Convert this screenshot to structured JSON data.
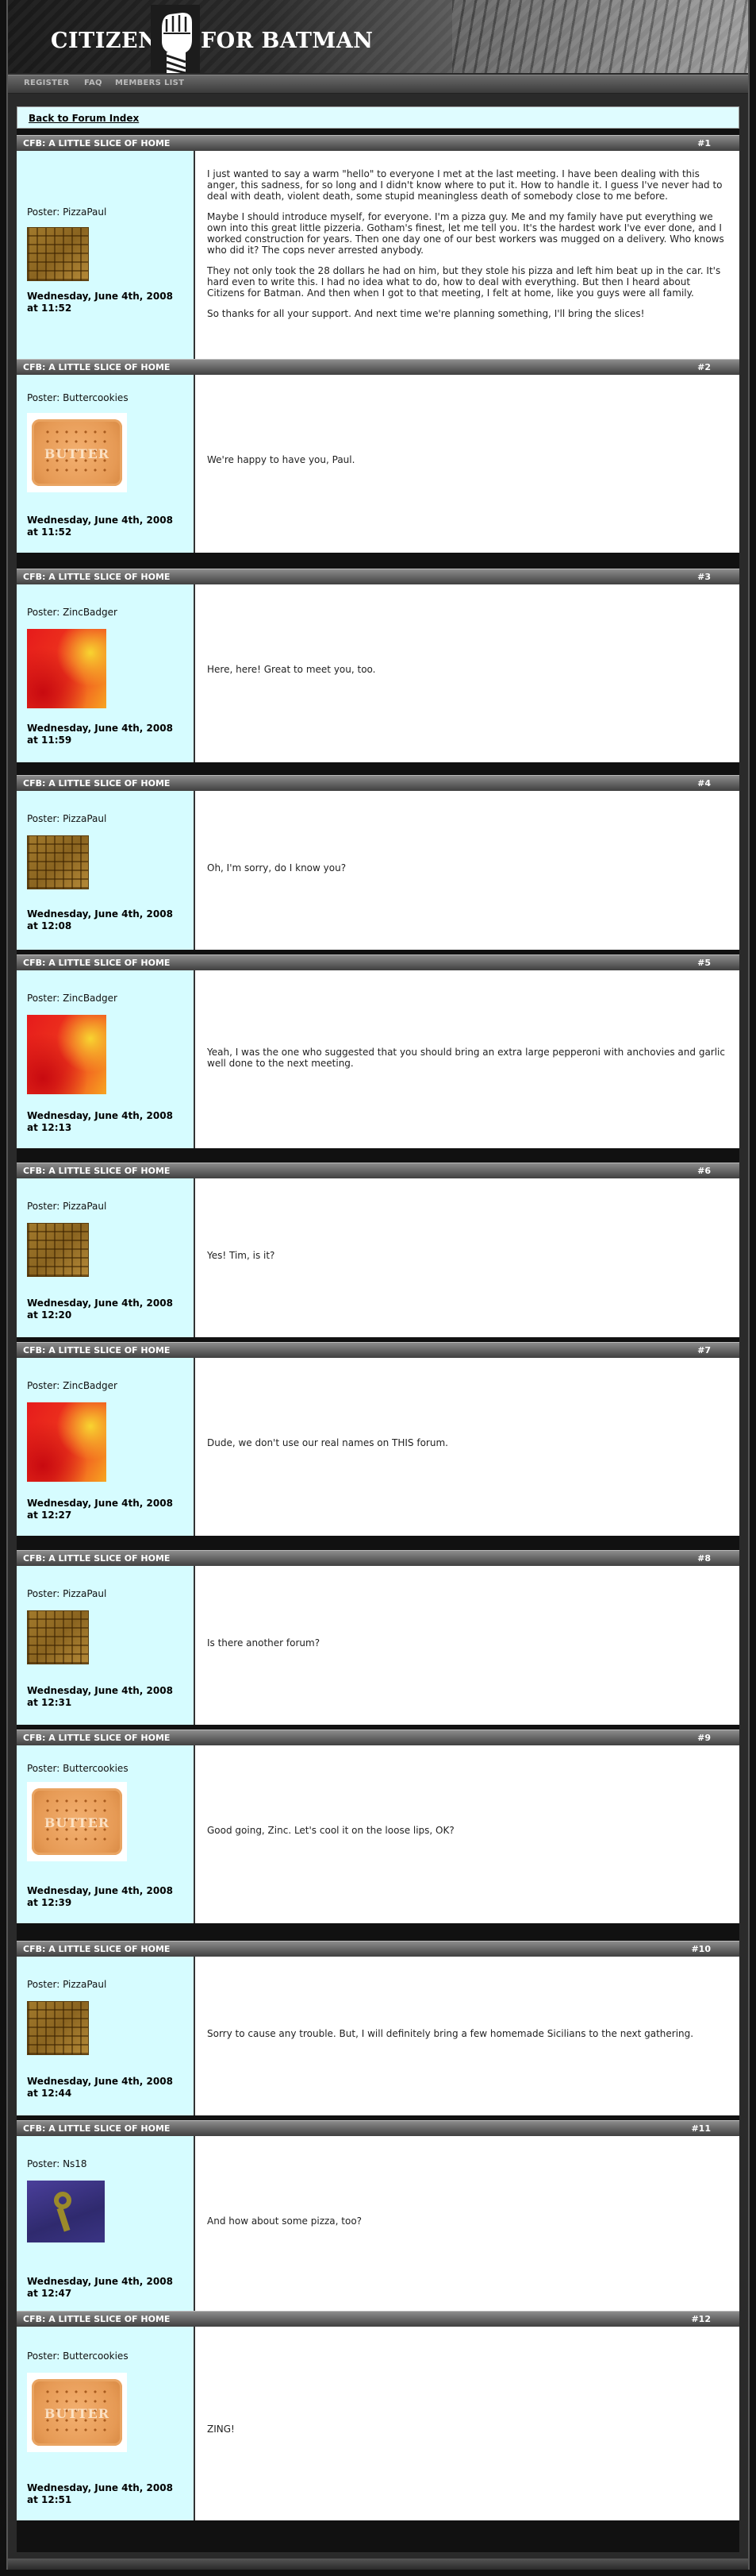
{
  "header": {
    "logo_left": "CITIZENS",
    "logo_right": "FOR BATMAN"
  },
  "nav": {
    "register": "REGISTER",
    "faq": "FAQ",
    "members": "MEMBERS LIST"
  },
  "back_link": "Back to Forum Index",
  "posts": [
    {
      "title": "CFB: A LITTLE SLICE OF HOME",
      "number": "#1",
      "poster": "Poster: PizzaPaul",
      "avatar": "pizza",
      "date": "Wednesday, June 4th, 2008 at 11:52",
      "paragraphs": [
        "I just wanted to say a warm \"hello\" to everyone I met at the last meeting. I have been dealing with this anger, this sadness, for so long and I didn't know where to put it. How to handle it. I guess I've never had to deal with death, violent death, some stupid meaningless death of somebody close to me before.",
        "Maybe I should introduce myself, for everyone. I'm a pizza guy. Me and my family have put everything we own into this great little pizzeria. Gotham's finest, let me tell you. It's the hardest work I've ever done, and I worked construction for years. Then one day one of our best workers was mugged on a delivery. Who knows who did it? The cops never arrested anybody.",
        "They not only took the 28 dollars he had on him, but they stole his pizza and left him beat up in the car. It's hard even to write this. I had no idea what to do, how to deal with everything. But then I heard about Citizens for Batman. And then when I got to that meeting, I felt at home, like you guys were all family.",
        "So thanks for all your support. And next time we're planning something, I'll bring the slices!"
      ]
    },
    {
      "title": "CFB: A LITTLE SLICE OF HOME",
      "number": "#2",
      "poster": "Poster: Buttercookies",
      "avatar": "butter",
      "date": "Wednesday, June 4th, 2008 at 11:52",
      "paragraphs": [
        "We're happy to have you, Paul."
      ]
    },
    {
      "title": "CFB: A LITTLE SLICE OF HOME",
      "number": "#3",
      "poster": "Poster: ZincBadger",
      "avatar": "zinc",
      "date": "Wednesday, June 4th, 2008 at 11:59",
      "paragraphs": [
        "Here, here! Great to meet you, too."
      ]
    },
    {
      "title": "CFB: A LITTLE SLICE OF HOME",
      "number": "#4",
      "poster": "Poster: PizzaPaul",
      "avatar": "pizza",
      "date": "Wednesday, June 4th, 2008 at 12:08",
      "paragraphs": [
        "Oh, I'm sorry, do I know you?"
      ]
    },
    {
      "title": "CFB: A LITTLE SLICE OF HOME",
      "number": "#5",
      "poster": "Poster: ZincBadger",
      "avatar": "zinc",
      "date": "Wednesday, June 4th, 2008 at 12:13",
      "paragraphs": [
        "Yeah, I was the one who suggested that you should bring an extra large pepperoni with anchovies and garlic well done to the next meeting."
      ]
    },
    {
      "title": "CFB: A LITTLE SLICE OF HOME",
      "number": "#6",
      "poster": "Poster: PizzaPaul",
      "avatar": "pizza",
      "date": "Wednesday, June 4th, 2008 at 12:20",
      "paragraphs": [
        "Yes! Tim, is it?"
      ]
    },
    {
      "title": "CFB: A LITTLE SLICE OF HOME",
      "number": "#7",
      "poster": "Poster: ZincBadger",
      "avatar": "zinc",
      "date": "Wednesday, June 4th, 2008 at 12:27",
      "paragraphs": [
        "Dude, we don't use our real names on THIS forum."
      ]
    },
    {
      "title": "CFB: A LITTLE SLICE OF HOME",
      "number": "#8",
      "poster": "Poster: PizzaPaul",
      "avatar": "pizza",
      "date": "Wednesday, June 4th, 2008 at 12:31",
      "paragraphs": [
        "Is there another forum?"
      ]
    },
    {
      "title": "CFB: A LITTLE SLICE OF HOME",
      "number": "#9",
      "poster": "Poster: Buttercookies",
      "avatar": "butter",
      "date": "Wednesday, June 4th, 2008 at 12:39",
      "paragraphs": [
        "Good going, Zinc. Let's cool it on the loose lips, OK?"
      ]
    },
    {
      "title": "CFB: A LITTLE SLICE OF HOME",
      "number": "#10",
      "poster": "Poster: PizzaPaul",
      "avatar": "pizza",
      "date": "Wednesday, June 4th, 2008 at 12:44",
      "paragraphs": [
        "Sorry to cause any trouble. But, I will definitely bring a few homemade Sicilians to the next gathering."
      ]
    },
    {
      "title": "CFB: A LITTLE SLICE OF HOME",
      "number": "#11",
      "poster": "Poster: Ns18",
      "avatar": "ns18",
      "date": "Wednesday, June 4th, 2008 at 12:47",
      "paragraphs": [
        "And how about some pizza, too?"
      ]
    },
    {
      "title": "CFB: A LITTLE SLICE OF HOME",
      "number": "#12",
      "poster": "Poster: Buttercookies",
      "avatar": "butter",
      "date": "Wednesday, June 4th, 2008 at 12:51",
      "paragraphs": [
        "ZING!"
      ]
    }
  ]
}
